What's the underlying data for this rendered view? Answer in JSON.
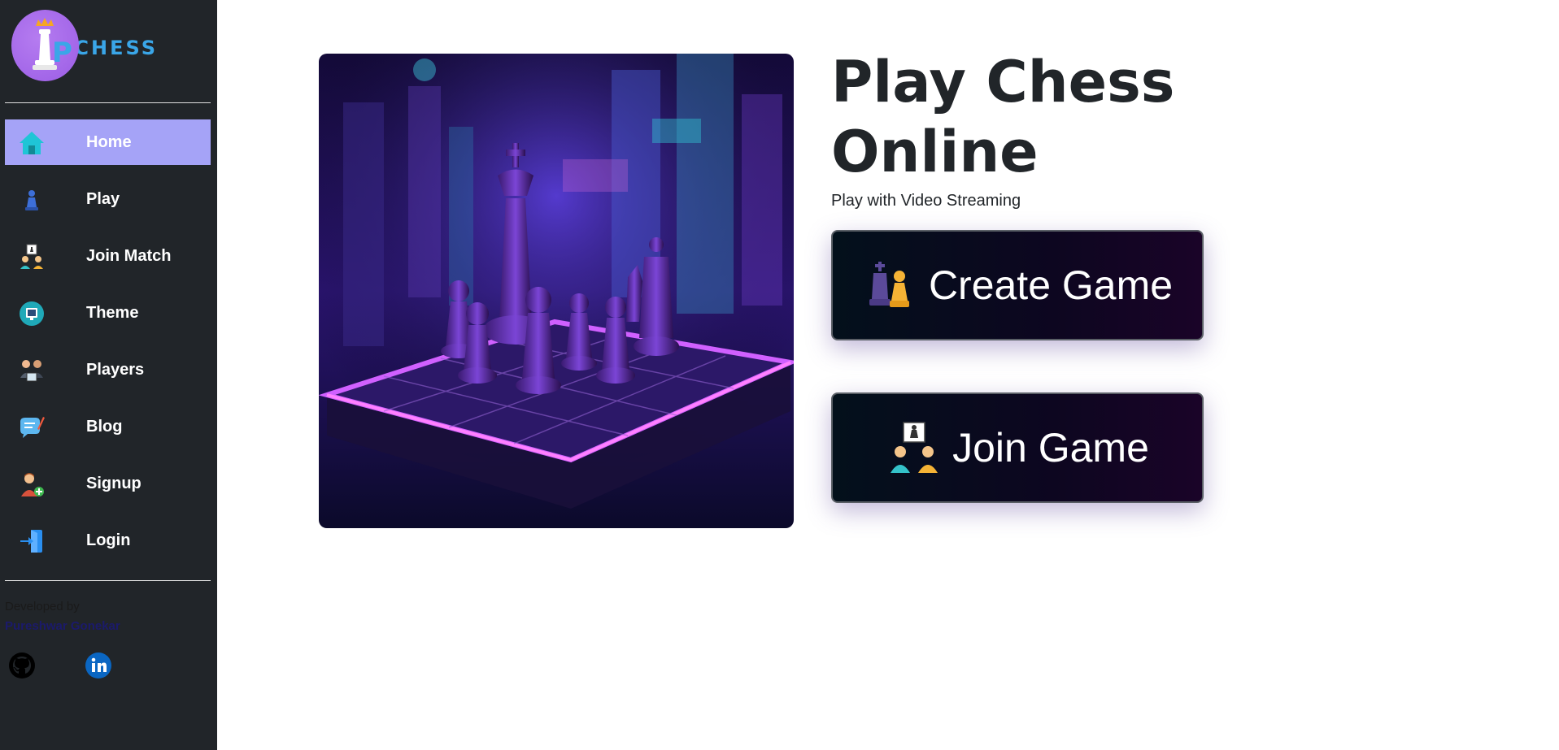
{
  "brand": {
    "name": "CHESS",
    "logo_letter": "P"
  },
  "sidebar": {
    "items": [
      {
        "label": "Home",
        "icon": "home-icon",
        "active": true
      },
      {
        "label": "Play",
        "icon": "chess-pawn-icon",
        "active": false
      },
      {
        "label": "Join Match",
        "icon": "join-match-icon",
        "active": false
      },
      {
        "label": "Theme",
        "icon": "theme-icon",
        "active": false
      },
      {
        "label": "Players",
        "icon": "players-icon",
        "active": false
      },
      {
        "label": "Blog",
        "icon": "blog-icon",
        "active": false
      },
      {
        "label": "Signup",
        "icon": "signup-icon",
        "active": false
      },
      {
        "label": "Login",
        "icon": "login-icon",
        "active": false
      }
    ],
    "footer": {
      "developed_by": "Developed by",
      "developer": "Pureshwar Gonekar",
      "social": [
        "github-icon",
        "linkedin-icon"
      ]
    }
  },
  "main": {
    "title": "Play Chess Online",
    "subtitle": "Play with Video Streaming",
    "buttons": {
      "create": "Create Game",
      "join": "Join Game"
    }
  },
  "colors": {
    "sidebar_bg": "#212529",
    "active_item": "#a5a3f7",
    "button_bg": "#0d0620",
    "brand_blue": "#3aa6e8",
    "logo_purple": "#9b5de5"
  }
}
